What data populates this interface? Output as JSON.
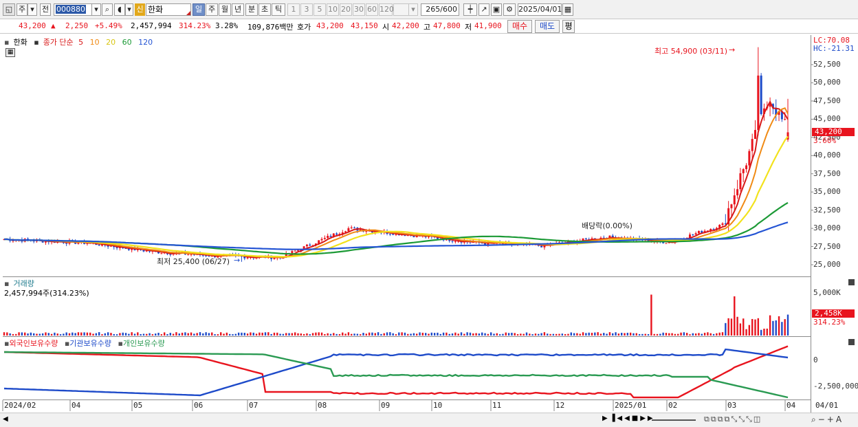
{
  "toolbar": {
    "market_type": "주",
    "prev_label": "전",
    "code": "000880",
    "name_badge": "신",
    "name": "한화",
    "periods": [
      "일",
      "주",
      "월",
      "년",
      "분",
      "초",
      "틱"
    ],
    "selected_period": "일",
    "intervals": [
      "1",
      "3",
      "5",
      "10",
      "20",
      "30",
      "60",
      "120"
    ],
    "count": "265",
    "count_max": "/600",
    "date": "2025/04/01"
  },
  "quote": {
    "price": "43,200",
    "arrow": "▲",
    "change": "2,250",
    "change_pct": "+5.49%",
    "volume": "2,457,994",
    "volume_pct": "314.23%",
    "turnover": "3.28%",
    "amount": "109,876백만",
    "hoga_label": "호가",
    "ask": "43,200",
    "bid": "43,150",
    "open_label": "시",
    "open": "42,200",
    "high_label": "고",
    "high": "47,800",
    "low_label": "저",
    "low": "41,900",
    "buy": "매수",
    "sell": "매도",
    "eval": "평"
  },
  "price_pane": {
    "stock": "한화",
    "ma_title": "종가 단순",
    "ma_periods": [
      "5",
      "10",
      "20",
      "60",
      "120"
    ],
    "ma_colors": [
      "#d81818",
      "#f08a14",
      "#f2e21c",
      "#1c9a36",
      "#2454d4"
    ],
    "lc": "LC:70.08",
    "hc": "HC:-21.31",
    "current": "43,200",
    "current_pct": "3.60%",
    "y_ticks": [
      "52,500",
      "50,000",
      "47,500",
      "45,000",
      "42,500",
      "40,000",
      "37,500",
      "35,000",
      "32,500",
      "30,000",
      "27,500",
      "25,000"
    ],
    "annotations": {
      "high": "최고 54,900 (03/11)",
      "low": "최저 25,400 (06/27)",
      "dividend": "배당락(0.00%)"
    }
  },
  "volume_pane": {
    "title": "거래량",
    "value": "2,457,994주(314.23%)",
    "y_tick": "5,000K",
    "current": "2,458K",
    "current_pct": "314.23%"
  },
  "holding_pane": {
    "labels": [
      "외국인보유수량",
      "기관보유수량",
      "개인보유수량"
    ],
    "colors": [
      "#e8141e",
      "#1d4ac9",
      "#2a9a52"
    ],
    "y_ticks": [
      "0",
      "-2,500,000"
    ]
  },
  "x_axis": [
    "2024/02",
    "04",
    "05",
    "06",
    "07",
    "08",
    "09",
    "10",
    "11",
    "12",
    "2025/01",
    "02",
    "03",
    "04"
  ],
  "x_axis_right": "04/01",
  "chart_data": {
    "type": "candlestick",
    "period": "2024/02 - 2025/04/01",
    "ylim": [
      24000,
      55500
    ],
    "price_months": [
      "2024/02",
      "04",
      "05",
      "06",
      "07",
      "08",
      "09",
      "10",
      "11",
      "12",
      "2025/01",
      "02",
      "03",
      "04"
    ],
    "close_monthly": [
      28500,
      28000,
      26800,
      26200,
      26000,
      30000,
      29000,
      28000,
      27600,
      28800,
      28100,
      30500,
      48000,
      43200
    ],
    "high": {
      "value": 54900,
      "date": "03/11"
    },
    "low": {
      "value": 25400,
      "date": "06/27"
    },
    "last": {
      "open": 42200,
      "high": 47800,
      "low": 41900,
      "close": 43200
    },
    "volume_last": 2457994
  }
}
